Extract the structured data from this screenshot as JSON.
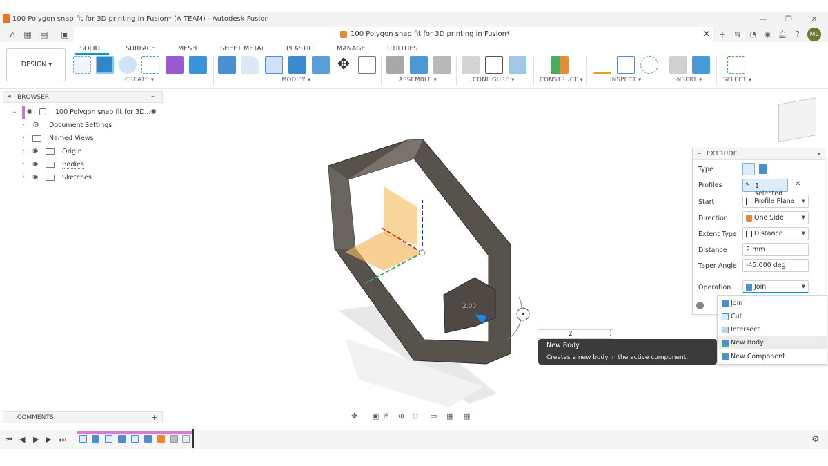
{
  "window": {
    "title": "100 Polygon snap fit for 3D printing in Fusion* (A TEAM) - Autodesk Fusion",
    "minimize": "—",
    "restore": "❐",
    "close": "✕"
  },
  "doc_tab": {
    "title": "100 Polygon snap fit for 3D printing in Fusion*",
    "close": "✕"
  },
  "user": {
    "initials": "ML"
  },
  "workspace": {
    "label": "DESIGN ▾"
  },
  "ribbon_tabs": [
    "SOLID",
    "SURFACE",
    "MESH",
    "SHEET METAL",
    "PLASTIC",
    "MANAGE",
    "UTILITIES"
  ],
  "ribbon_groups": {
    "create": "CREATE ▾",
    "modify": "MODIFY ▾",
    "assemble": "ASSEMBLE ▾",
    "configure": "CONFIGURE ▾",
    "construct": "CONSTRUCT ▾",
    "inspect": "INSPECT ▾",
    "insert": "INSERT ▾",
    "select": "SELECT ▾"
  },
  "browser": {
    "title": "BROWSER",
    "collapse": "–",
    "root": "100 Polygon snap fit for 3D...",
    "items": [
      "Document Settings",
      "Named Views",
      "Origin",
      "Bodies",
      "Sketches"
    ]
  },
  "comments": {
    "label": "COMMENTS",
    "add": "+"
  },
  "extrude": {
    "title": "EXTRUDE",
    "rows": {
      "type": "Type",
      "profiles": "Profiles",
      "profiles_value": "1 selected",
      "start": "Start",
      "start_value": "Profile Plane",
      "direction": "Direction",
      "direction_value": "One Side",
      "extent_type": "Extent Type",
      "extent_value": "Distance",
      "distance": "Distance",
      "distance_value": "2 mm",
      "taper": "Taper Angle",
      "taper_value": "-45.000 deg",
      "operation": "Operation",
      "operation_value": "Join"
    }
  },
  "operation_options": [
    "Join",
    "Cut",
    "Intersect",
    "New Body",
    "New Component"
  ],
  "tooltip": {
    "title": "New Body",
    "description": "Creates a new body in the active component."
  },
  "viewport": {
    "distance_input": "2",
    "dim_label": "2.00"
  },
  "colors": {
    "accent": "#0696d7",
    "timeline": "#d97bd6",
    "body": "#5a5550"
  }
}
